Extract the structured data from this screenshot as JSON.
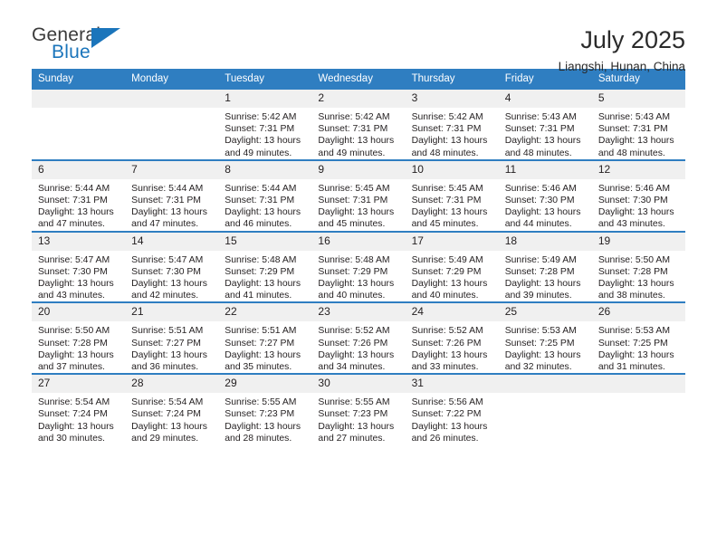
{
  "brand": {
    "name_top": "General",
    "name_bottom": "Blue",
    "triangle_color": "#1b75bb"
  },
  "header": {
    "title": "July 2025",
    "location": "Liangshi, Hunan, China"
  },
  "theme": {
    "header_blue": "#2f7ec1",
    "daynum_gray": "#f0f0f0",
    "text": "#231f20"
  },
  "weekday_headers": [
    "Sunday",
    "Monday",
    "Tuesday",
    "Wednesday",
    "Thursday",
    "Friday",
    "Saturday"
  ],
  "labels": {
    "sunrise_prefix": "Sunrise: ",
    "sunset_prefix": "Sunset: ",
    "daylight_prefix": "Daylight: "
  },
  "weeks": [
    [
      {
        "day": "",
        "sunrise": "",
        "sunset": "",
        "daylight": ""
      },
      {
        "day": "",
        "sunrise": "",
        "sunset": "",
        "daylight": ""
      },
      {
        "day": "1",
        "sunrise": "Sunrise: 5:42 AM",
        "sunset": "Sunset: 7:31 PM",
        "daylight": "Daylight: 13 hours and 49 minutes."
      },
      {
        "day": "2",
        "sunrise": "Sunrise: 5:42 AM",
        "sunset": "Sunset: 7:31 PM",
        "daylight": "Daylight: 13 hours and 49 minutes."
      },
      {
        "day": "3",
        "sunrise": "Sunrise: 5:42 AM",
        "sunset": "Sunset: 7:31 PM",
        "daylight": "Daylight: 13 hours and 48 minutes."
      },
      {
        "day": "4",
        "sunrise": "Sunrise: 5:43 AM",
        "sunset": "Sunset: 7:31 PM",
        "daylight": "Daylight: 13 hours and 48 minutes."
      },
      {
        "day": "5",
        "sunrise": "Sunrise: 5:43 AM",
        "sunset": "Sunset: 7:31 PM",
        "daylight": "Daylight: 13 hours and 48 minutes."
      }
    ],
    [
      {
        "day": "6",
        "sunrise": "Sunrise: 5:44 AM",
        "sunset": "Sunset: 7:31 PM",
        "daylight": "Daylight: 13 hours and 47 minutes."
      },
      {
        "day": "7",
        "sunrise": "Sunrise: 5:44 AM",
        "sunset": "Sunset: 7:31 PM",
        "daylight": "Daylight: 13 hours and 47 minutes."
      },
      {
        "day": "8",
        "sunrise": "Sunrise: 5:44 AM",
        "sunset": "Sunset: 7:31 PM",
        "daylight": "Daylight: 13 hours and 46 minutes."
      },
      {
        "day": "9",
        "sunrise": "Sunrise: 5:45 AM",
        "sunset": "Sunset: 7:31 PM",
        "daylight": "Daylight: 13 hours and 45 minutes."
      },
      {
        "day": "10",
        "sunrise": "Sunrise: 5:45 AM",
        "sunset": "Sunset: 7:31 PM",
        "daylight": "Daylight: 13 hours and 45 minutes."
      },
      {
        "day": "11",
        "sunrise": "Sunrise: 5:46 AM",
        "sunset": "Sunset: 7:30 PM",
        "daylight": "Daylight: 13 hours and 44 minutes."
      },
      {
        "day": "12",
        "sunrise": "Sunrise: 5:46 AM",
        "sunset": "Sunset: 7:30 PM",
        "daylight": "Daylight: 13 hours and 43 minutes."
      }
    ],
    [
      {
        "day": "13",
        "sunrise": "Sunrise: 5:47 AM",
        "sunset": "Sunset: 7:30 PM",
        "daylight": "Daylight: 13 hours and 43 minutes."
      },
      {
        "day": "14",
        "sunrise": "Sunrise: 5:47 AM",
        "sunset": "Sunset: 7:30 PM",
        "daylight": "Daylight: 13 hours and 42 minutes."
      },
      {
        "day": "15",
        "sunrise": "Sunrise: 5:48 AM",
        "sunset": "Sunset: 7:29 PM",
        "daylight": "Daylight: 13 hours and 41 minutes."
      },
      {
        "day": "16",
        "sunrise": "Sunrise: 5:48 AM",
        "sunset": "Sunset: 7:29 PM",
        "daylight": "Daylight: 13 hours and 40 minutes."
      },
      {
        "day": "17",
        "sunrise": "Sunrise: 5:49 AM",
        "sunset": "Sunset: 7:29 PM",
        "daylight": "Daylight: 13 hours and 40 minutes."
      },
      {
        "day": "18",
        "sunrise": "Sunrise: 5:49 AM",
        "sunset": "Sunset: 7:28 PM",
        "daylight": "Daylight: 13 hours and 39 minutes."
      },
      {
        "day": "19",
        "sunrise": "Sunrise: 5:50 AM",
        "sunset": "Sunset: 7:28 PM",
        "daylight": "Daylight: 13 hours and 38 minutes."
      }
    ],
    [
      {
        "day": "20",
        "sunrise": "Sunrise: 5:50 AM",
        "sunset": "Sunset: 7:28 PM",
        "daylight": "Daylight: 13 hours and 37 minutes."
      },
      {
        "day": "21",
        "sunrise": "Sunrise: 5:51 AM",
        "sunset": "Sunset: 7:27 PM",
        "daylight": "Daylight: 13 hours and 36 minutes."
      },
      {
        "day": "22",
        "sunrise": "Sunrise: 5:51 AM",
        "sunset": "Sunset: 7:27 PM",
        "daylight": "Daylight: 13 hours and 35 minutes."
      },
      {
        "day": "23",
        "sunrise": "Sunrise: 5:52 AM",
        "sunset": "Sunset: 7:26 PM",
        "daylight": "Daylight: 13 hours and 34 minutes."
      },
      {
        "day": "24",
        "sunrise": "Sunrise: 5:52 AM",
        "sunset": "Sunset: 7:26 PM",
        "daylight": "Daylight: 13 hours and 33 minutes."
      },
      {
        "day": "25",
        "sunrise": "Sunrise: 5:53 AM",
        "sunset": "Sunset: 7:25 PM",
        "daylight": "Daylight: 13 hours and 32 minutes."
      },
      {
        "day": "26",
        "sunrise": "Sunrise: 5:53 AM",
        "sunset": "Sunset: 7:25 PM",
        "daylight": "Daylight: 13 hours and 31 minutes."
      }
    ],
    [
      {
        "day": "27",
        "sunrise": "Sunrise: 5:54 AM",
        "sunset": "Sunset: 7:24 PM",
        "daylight": "Daylight: 13 hours and 30 minutes."
      },
      {
        "day": "28",
        "sunrise": "Sunrise: 5:54 AM",
        "sunset": "Sunset: 7:24 PM",
        "daylight": "Daylight: 13 hours and 29 minutes."
      },
      {
        "day": "29",
        "sunrise": "Sunrise: 5:55 AM",
        "sunset": "Sunset: 7:23 PM",
        "daylight": "Daylight: 13 hours and 28 minutes."
      },
      {
        "day": "30",
        "sunrise": "Sunrise: 5:55 AM",
        "sunset": "Sunset: 7:23 PM",
        "daylight": "Daylight: 13 hours and 27 minutes."
      },
      {
        "day": "31",
        "sunrise": "Sunrise: 5:56 AM",
        "sunset": "Sunset: 7:22 PM",
        "daylight": "Daylight: 13 hours and 26 minutes."
      },
      {
        "day": "",
        "sunrise": "",
        "sunset": "",
        "daylight": ""
      },
      {
        "day": "",
        "sunrise": "",
        "sunset": "",
        "daylight": ""
      }
    ]
  ]
}
